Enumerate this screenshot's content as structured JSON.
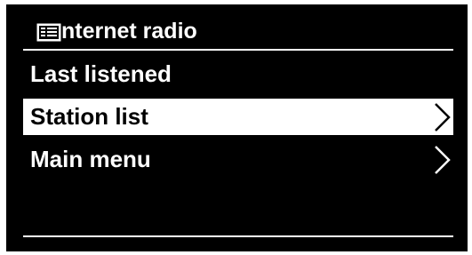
{
  "header": {
    "icon": "internet-radio-icon",
    "title": "nternet radio"
  },
  "menu": {
    "items": [
      {
        "label": "Last listened",
        "selected": false,
        "has_submenu": false
      },
      {
        "label": "Station list",
        "selected": true,
        "has_submenu": true
      },
      {
        "label": "Main menu",
        "selected": false,
        "has_submenu": true
      }
    ]
  },
  "colors": {
    "background": "#000000",
    "foreground": "#ffffff",
    "highlight": "#ffffff",
    "highlight_text": "#000000"
  }
}
